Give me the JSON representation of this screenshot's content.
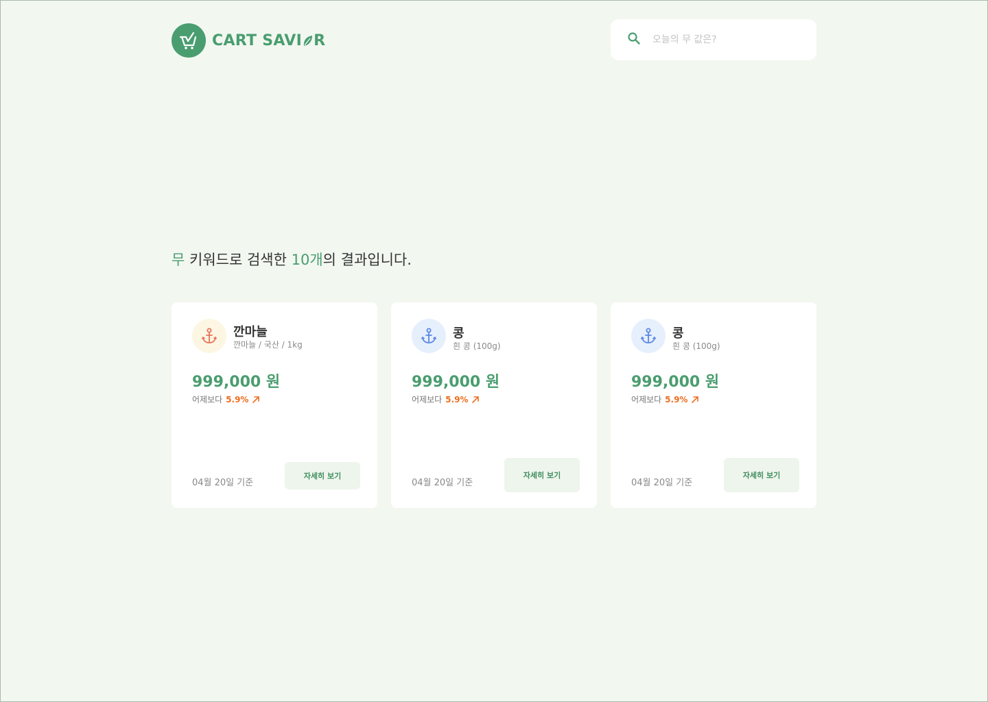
{
  "brand": {
    "name_part1": "CART SAVI",
    "name_part2": "R",
    "logo_icon": "basket-icon",
    "leaf_icon": "leaf-icon",
    "accent_color": "#4a9d6f"
  },
  "search": {
    "placeholder": "오늘의 무 값은?",
    "icon": "search-icon"
  },
  "results": {
    "keyword": "무",
    "text_middle": " 키워드로 검색한 ",
    "count": "10개",
    "text_end": "의 결과입니다."
  },
  "cards": [
    {
      "name": "깐마늘",
      "subtitle": "깐마늘 / 국산 / 1kg",
      "price": "999,000 원",
      "change_label": "어제보다",
      "change_pct": "5.9%",
      "change_direction": "up",
      "date": "04월 20일 기준",
      "button_label": "자세히 보기",
      "icon": "anchor-icon",
      "icon_color": "#e8735a",
      "icon_bg": "#fdf6e3"
    },
    {
      "name": "콩",
      "subtitle": "흰 콩 (100g)",
      "price": "999,000 원",
      "change_label": "어제보다",
      "change_pct": "5.9%",
      "change_direction": "up",
      "date": "04월 20일 기준",
      "button_label": "자세히 보기",
      "icon": "anchor-icon",
      "icon_color": "#5b86e5",
      "icon_bg": "#e6effc"
    },
    {
      "name": "콩",
      "subtitle": "흰 콩 (100g)",
      "price": "999,000 원",
      "change_label": "어제보다",
      "change_pct": "5.9%",
      "change_direction": "up",
      "date": "04월 20일 기준",
      "button_label": "자세히 보기",
      "icon": "anchor-icon",
      "icon_color": "#5b86e5",
      "icon_bg": "#e6effc"
    }
  ]
}
